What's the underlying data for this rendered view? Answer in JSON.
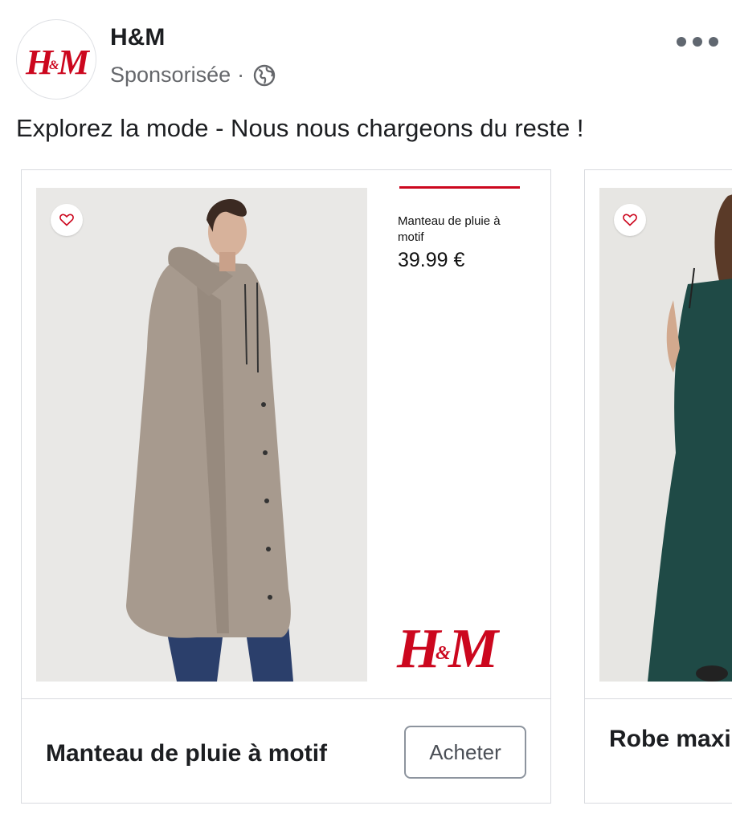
{
  "post": {
    "page_name": "H&M",
    "sponsored_label": "Sponsorisée",
    "separator": "·",
    "caption": "Explorez la mode - Nous nous chargeons du reste !"
  },
  "brand": {
    "logo_text": "H&M",
    "accent": "#cc071e"
  },
  "carousel": [
    {
      "image_product_name": "Manteau de pluie à motif",
      "image_price": "39.99 €",
      "title": "Manteau de pluie à motif",
      "cta_label": "Acheter"
    },
    {
      "title": "Robe maxi en V"
    }
  ]
}
